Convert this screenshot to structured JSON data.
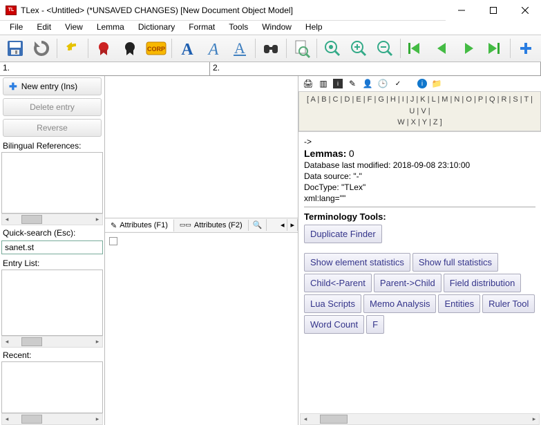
{
  "title": "TLex - <Untitled> (*UNSAVED CHANGES) [New Document Object Model]",
  "menu": [
    "File",
    "Edit",
    "View",
    "Lemma",
    "Dictionary",
    "Format",
    "Tools",
    "Window",
    "Help"
  ],
  "workcells": {
    "c1": "1.",
    "c2": "2."
  },
  "left": {
    "new_entry": "New entry (Ins)",
    "delete_entry": "Delete entry",
    "reverse": "Reverse",
    "bilingual": "Bilingual References:",
    "quicksearch_label": "Quick-search (Esc):",
    "quicksearch_value": "sanet.st",
    "entry_list": "Entry List:",
    "recent": "Recent:"
  },
  "tabs": {
    "attr1": "Attributes (F1)",
    "attr2": "Attributes (F2)"
  },
  "alpha_row1": "[ A | B | C | D | E | F | G | H | I | J | K | L | M | N | O | P | Q | R | S | T | U | V |",
  "alpha_row2": "W | X | Y | Z ]",
  "info": {
    "arrow": "->",
    "lemmas_label": "Lemmas:",
    "lemmas_count": "0",
    "db_modified": "Database last modified: 2018-09-08 23:10:00",
    "data_source": "Data source: \"-\"",
    "doctype": "DocType: \"TLex\"",
    "xmllang": "xml:lang=\"\""
  },
  "term_title": "Terminology Tools:",
  "term_buttons": [
    "Duplicate Finder"
  ],
  "term_buttons2": [
    "Show element statistics",
    "Show full statistics",
    "Child<-Parent",
    "Parent->Child",
    "Field distribution",
    "Lua Scripts",
    "Memo Analysis",
    "Entities",
    "Ruler Tool",
    "Word Count",
    "F"
  ]
}
